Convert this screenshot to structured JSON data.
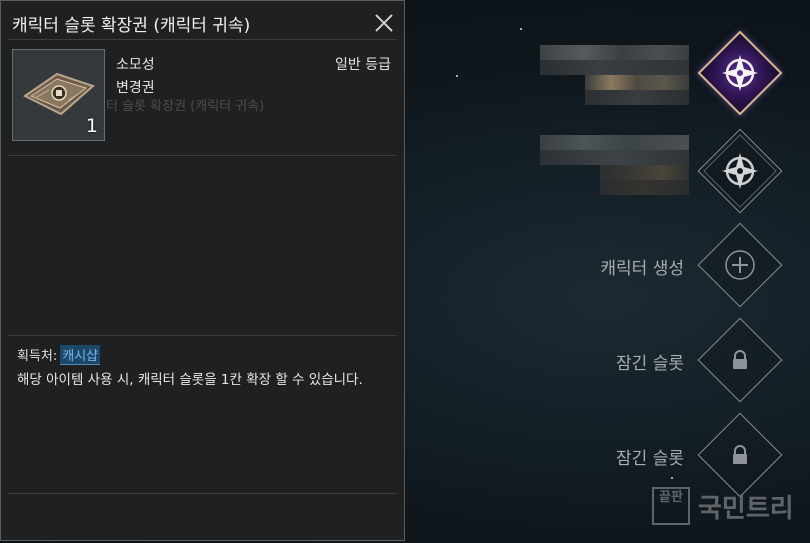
{
  "tooltip": {
    "title": "캐릭터 슬롯 확장권 (캐릭터 귀속)",
    "item_type": "소모성",
    "item_grade": "일반 등급",
    "item_subtype": "변경권",
    "item_count": "1",
    "ghost_text": "터 슬롯 확장권 (캐릭터 귀속)",
    "source_label": "획득처:",
    "source_link": "캐시샵",
    "description": "해당 아이템 사용 시, 캐릭터 슬롯을 1칸 확장 할 수 있습니다."
  },
  "slots": [
    {
      "state": "selected",
      "icon": "compass-emblem-icon"
    },
    {
      "state": "occupied",
      "icon": "compass-emblem-icon"
    },
    {
      "state": "create",
      "label": "캐릭터 생성",
      "icon": "plus-icon"
    },
    {
      "state": "locked",
      "label": "잠긴 슬롯",
      "icon": "lock-icon"
    },
    {
      "state": "locked",
      "label": "잠긴 슬롯",
      "icon": "lock-icon"
    }
  ],
  "watermark": {
    "box_text": "끝판",
    "text": "국민트리"
  },
  "colors": {
    "panel_bg": "#1f2021",
    "link_bg": "#1d4767",
    "active_border": "#d8b98a",
    "active_fill": "#5b2d8f"
  }
}
